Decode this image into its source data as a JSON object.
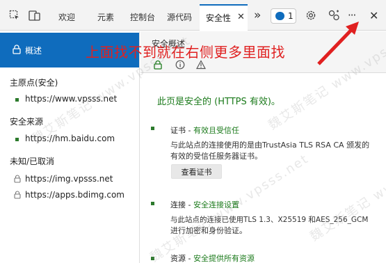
{
  "toolbar": {
    "tabs": [
      "欢迎",
      "元素",
      "控制台",
      "源代码"
    ],
    "active_tab": "安全性",
    "close_glyph": "✕",
    "more_tabs_glyph": "»",
    "issues_count": "1",
    "more_glyph": "···",
    "close_devtools_glyph": "✕"
  },
  "sidebar": {
    "overview_label": "概述",
    "main_origin_heading": "主原点(安全)",
    "main_origin_url": "https://www.vpsss.net",
    "secure_sources_heading": "安全来源",
    "secure_source_url": "https://hm.baidu.com",
    "unknown_heading": "未知/已取消",
    "unknown_urls": [
      "https://img.vpsss.net",
      "https://apps.bdimg.com"
    ]
  },
  "main": {
    "title": "安全概述",
    "callout": "上面找不到就在右侧更多里面找",
    "secure_message": "此页是安全的 (HTTPS 有效)。",
    "certificate": {
      "label": "证书 - ",
      "status": "有效且受信任",
      "desc_line1": "与此站点的连接使用的是由TrustAsia TLS RSA CA 颁发的",
      "desc_line2": "有效的受信任服务器证书。",
      "button": "查看证书"
    },
    "connection": {
      "label": "连接 - ",
      "status": "安全连接设置",
      "desc_line1": "与此站点的连接已使用TLS 1.3、X25519 和AES_256_GCM",
      "desc_line2": "进行加密和身份验证。"
    },
    "resources": {
      "label": "资源 - ",
      "status": "安全提供所有资源"
    }
  },
  "watermark": "魏艾斯笔记 www.vpsss.net",
  "colors": {
    "accent": "#0f6cbd",
    "secure_green": "#1b7a1b",
    "callout_red": "#e02020"
  }
}
